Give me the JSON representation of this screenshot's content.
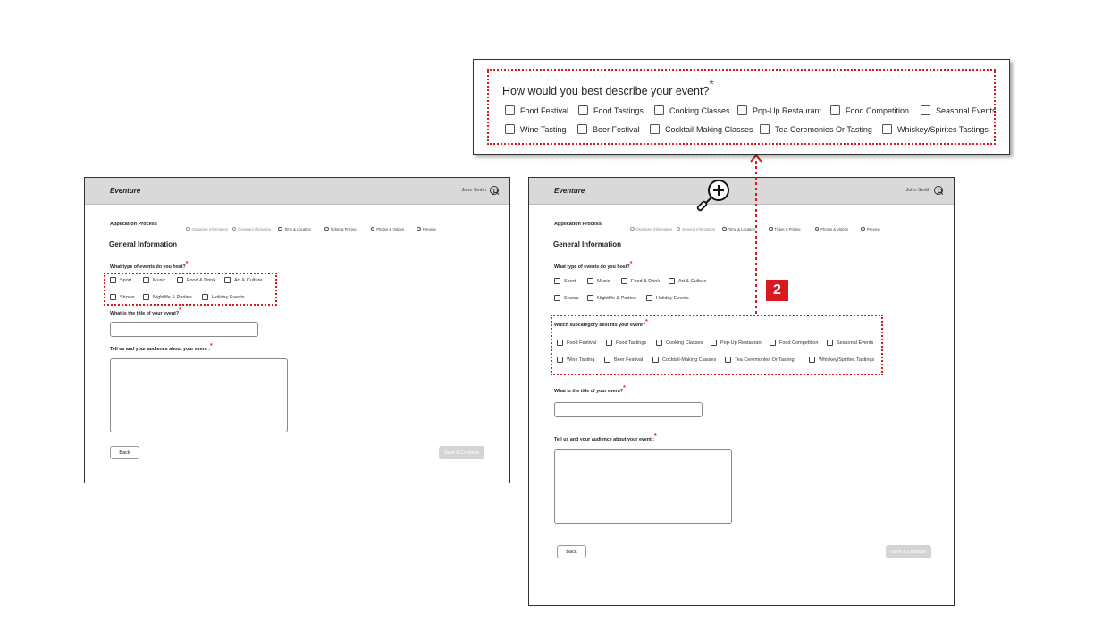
{
  "app": {
    "brand": "Eventure",
    "user_name": "John Smith"
  },
  "app_process_label": "Application Process",
  "steps": [
    "Organizer Information",
    "General Information",
    "Time & Location",
    "Ticket & Pricing",
    "Photos & Videos",
    "Preview"
  ],
  "section_title": "General Information",
  "event_types_question": "What type of events do you host?",
  "event_types": [
    "Sport",
    "Music",
    "Food & Drink",
    "Art & Culture",
    "Shows",
    "Nightlife & Parties",
    "Holiday Events"
  ],
  "subcategory_question": "Which subcategory best fits your event?",
  "subcategories": [
    "Food Festival",
    "Food Tastings",
    "Cooking Classes",
    "Pop-Up Restaurant",
    "Food Competition",
    "Seasonal Events",
    "Wine Tasting",
    "Beer Festival",
    "Cocktail-Making Classes",
    "Tea Ceremonies Or Tasting",
    "Whiskey/Spirites Tastings"
  ],
  "title_question": "What is the title of your event?",
  "audience_question": "Tell us and your audience about your event :",
  "buttons": {
    "back": "Back",
    "save": "Save & Continue"
  },
  "zoom": {
    "question": "How would you best describe your event?",
    "options": [
      "Food Festival",
      "Food Tastings",
      "Cooking Classes",
      "Pop-Up Restaurant",
      "Food Competition",
      "Seasonal Events",
      "Wine Tasting",
      "Beer Festival",
      "Cocktail-Making Classes",
      "Tea Ceremonies Or Tasting",
      "Whiskey/Spirites Tastings"
    ]
  },
  "annotation_badge": "2",
  "required_mark": "*",
  "colors": {
    "highlight": "#d71920",
    "topbar": "#d9d9d9",
    "disabled_button": "#d4d4d4"
  },
  "icons": {
    "zoom": "zoom-in-magnifier-icon",
    "user": "user-circle-icon"
  }
}
